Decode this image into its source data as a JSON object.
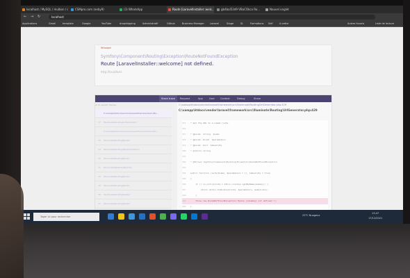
{
  "browser": {
    "tabs": [
      {
        "label": "localhost / MySQL / mulbon / co...",
        "color": "#e67e22",
        "active": false
      },
      {
        "label": "CSMpro.com (eeby9)",
        "color": "#3498db",
        "active": false
      },
      {
        "label": "(3) WhatsApp",
        "color": "#27ae60",
        "active": false
      },
      {
        "label": "Route [LaravelInstaller::welc...",
        "color": "#e74c3c",
        "active": true
      },
      {
        "label": "gb4bal53d9 VBaCOkca Ro...",
        "color": "#7f8c8d",
        "active": false
      },
      {
        "label": "Nouvel onglet",
        "color": "#95a5a6",
        "active": false
      }
    ],
    "url": "localhost",
    "bookmarks": [
      "Applications",
      "Gmail",
      "template",
      "Google",
      "YouTube",
      "dropshipping",
      "Administratif",
      "Github",
      "Business Manager",
      "Laravel",
      "Stage",
      "SL",
      "Formations",
      "Self",
      "A ordisr",
      "Autres favoris",
      "Liste de lecture"
    ]
  },
  "error": {
    "tag": "Whoops!",
    "exception_class": "Symfony\\Component\\Routing\\Exception\\RouteNotFoundException",
    "message": "Route [LaravelInstaller::welcome] not defined.",
    "url": "http://localhost"
  },
  "trace": {
    "tabs": [
      "Stack trace",
      "Request",
      "App",
      "User",
      "Context",
      "Debug",
      "Share"
    ],
    "frames": [
      {
        "num": "",
        "label": "C:\\xampp\\htdocs\\vendor\\laravel\\framework\\src\\Illu..."
      },
      {
        "num": "37",
        "label": "Illuminate\\Routing\\UrlGenerator"
      },
      {
        "num": "",
        "label": "C:\\xampp\\htdocs\\vendor\\laravel\\framework\\src\\Illu..."
      },
      {
        "num": "45",
        "label": "Illuminate\\Routing\\Router"
      },
      {
        "num": "44",
        "label": "Illuminate\\Routing\\RouteCollection"
      },
      {
        "num": "42",
        "label": "Illuminate\\Routing\\Route"
      },
      {
        "num": "41",
        "label": "Illuminate\\Pipeline\\Pipeline"
      },
      {
        "num": "40",
        "label": "Illuminate\\Routing\\Route"
      },
      {
        "num": "39",
        "label": "Illuminate\\Routing\\Route"
      },
      {
        "num": "38",
        "label": "Illuminate\\Routing\\Router"
      },
      {
        "num": "37",
        "label": "Illuminate\\Routing\\Router"
      },
      {
        "num": "36",
        "label": "Illuminate\\Routing\\Router"
      }
    ],
    "code_path": "C:\\xampp\\htdocs\\vendor\\laravel\\framework\\src\\Illuminate\\Routing\\UrlGenerator.php:429",
    "code_header": "C:\\xampp\\htdocs\\vendor\\laravel\\framework\\src\\Illuminate\\Routing\\UrlGenerator.php:429",
    "code_lines": [
      {
        "n": "415",
        "t": "* Get the URL to a named route."
      },
      {
        "n": "416",
        "t": ""
      },
      {
        "n": "417",
        "t": "* @param  string  $name"
      },
      {
        "n": "418",
        "t": "* @param  mixed  $parameters"
      },
      {
        "n": "419",
        "t": "* @param  bool  $absolute"
      },
      {
        "n": "420",
        "t": "* @return string"
      },
      {
        "n": "421",
        "t": ""
      },
      {
        "n": "422",
        "t": "* @throws \\Symfony\\Component\\Routing\\Exception\\RouteNotFoundException"
      },
      {
        "n": "423",
        "t": ""
      },
      {
        "n": "424",
        "t": "public function route($name, $parameters = [], $absolute = true)"
      },
      {
        "n": "425",
        "t": "{"
      },
      {
        "n": "426",
        "t": "    if (! is_null($route = $this->routes->getByName($name))) {"
      },
      {
        "n": "427",
        "t": "        return $this->toRoute($route, $parameters, $absolute);"
      },
      {
        "n": "428",
        "t": "    }"
      },
      {
        "n": "429",
        "t": "    throw new RouteNotFoundException(\"Route [{$name}] not defined.\");"
      },
      {
        "n": "430",
        "t": "}"
      }
    ],
    "highlight_line": "429"
  },
  "taskbar": {
    "search_placeholder": "Taper ici pour rechercher",
    "weather": "23°C Nuageux",
    "time": "13:47",
    "date": "17/12/2021"
  }
}
